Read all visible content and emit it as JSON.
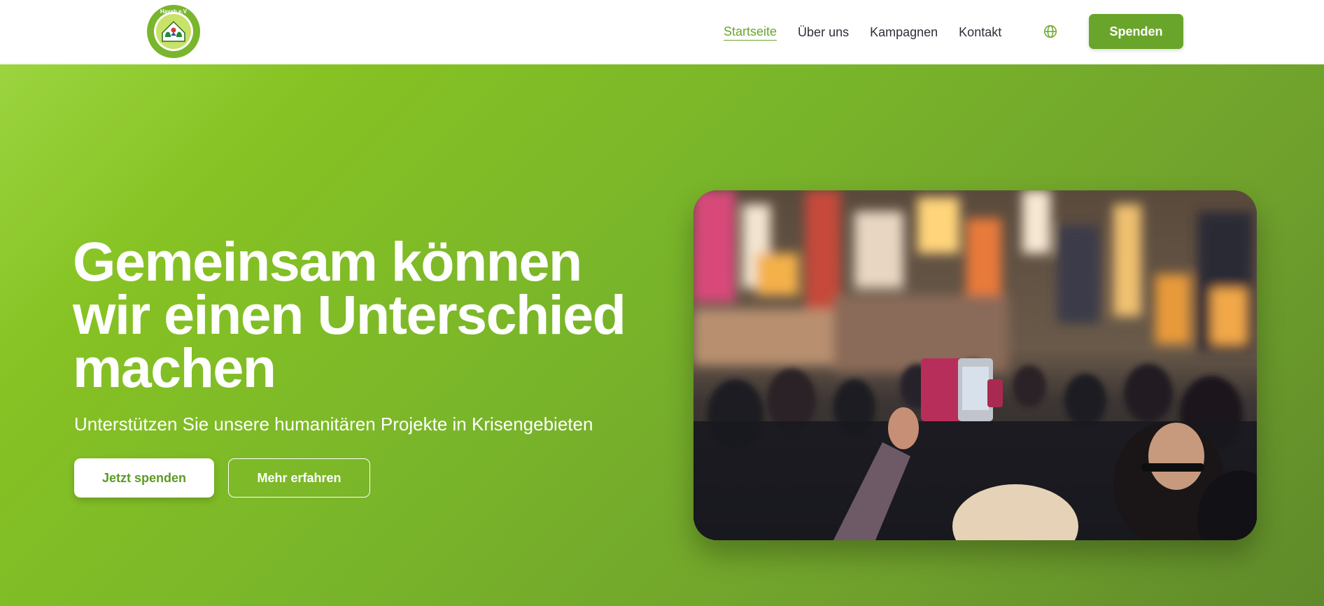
{
  "brand": {
    "logo_icon": "hayah-ev-logo",
    "logo_text_top": "Hayah e.V",
    "accent_color": "#6aa52b"
  },
  "nav": {
    "items": [
      {
        "label": "Startseite",
        "active": true
      },
      {
        "label": "Über uns",
        "active": false
      },
      {
        "label": "Kampagnen",
        "active": false
      },
      {
        "label": "Kontakt",
        "active": false
      }
    ],
    "language_icon": "globe-icon",
    "donate_label": "Spenden"
  },
  "hero": {
    "title_line1": "Gemeinsam können",
    "title_line2": "wir einen Unterschied",
    "title_line3": "machen",
    "subtitle": "Unterstützen Sie unsere humanitären Projekte in Krisengebieten",
    "primary_cta": "Jetzt spenden",
    "secondary_cta": "Mehr erfahren",
    "image_subject": "crowded-city-street-photo",
    "gradient_colors": [
      "#9bd43f",
      "#79b52a",
      "#5f8a2a"
    ]
  }
}
